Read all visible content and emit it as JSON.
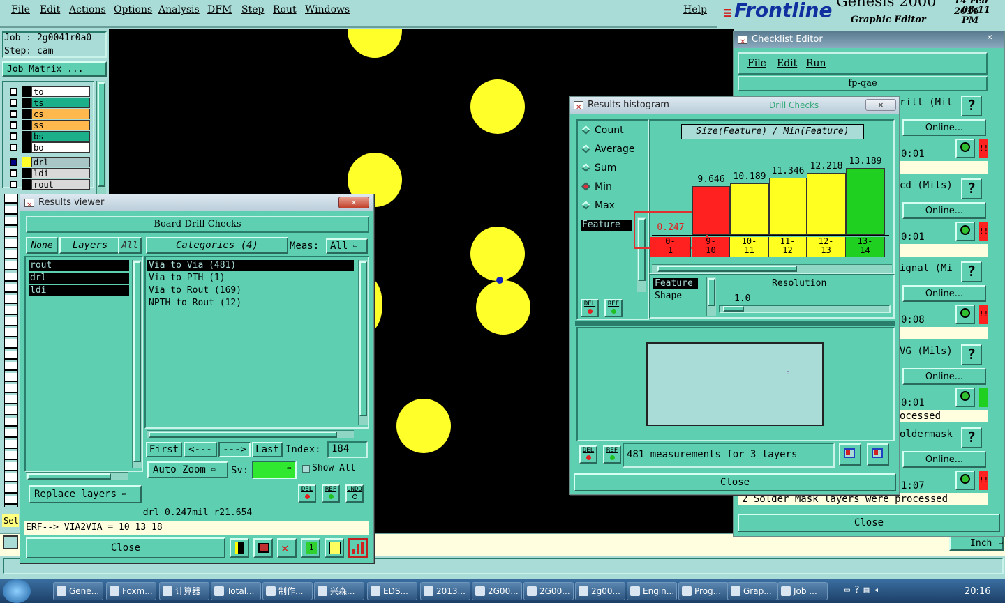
{
  "menubar": {
    "items": [
      "File",
      "Edit",
      "Actions",
      "Options",
      "Analysis",
      "DFM",
      "Step",
      "Rout",
      "Windows"
    ],
    "help": "Help"
  },
  "brand": {
    "logo": "Frontline",
    "product": "Genesis 2000",
    "subtitle": "Graphic Editor",
    "date": "14 Feb 2016",
    "time": "08:11 PM"
  },
  "left": {
    "job": "Job : 2g0041r0a0",
    "step": "Step: cam",
    "job_matrix": "Job Matrix ...",
    "layers": [
      {
        "name": "to",
        "color": "#ffffff"
      },
      {
        "name": "ts",
        "color": "#1cb08a"
      },
      {
        "name": "cs",
        "color": "#ffb84d"
      },
      {
        "name": "ss",
        "color": "#ffb84d"
      },
      {
        "name": "bs",
        "color": "#1cb08a"
      },
      {
        "name": "bo",
        "color": "#ffffff"
      },
      {
        "name": "drl",
        "color": "#a9c6c6"
      },
      {
        "name": "ldi",
        "color": "#d9d9d9"
      },
      {
        "name": "rout",
        "color": "#d9d9d9"
      }
    ],
    "sel_label": "Sel"
  },
  "results_viewer": {
    "title": "Results viewer",
    "header": "Board-Drill Checks",
    "none": "None",
    "layers": "Layers",
    "all": "All",
    "categories": "Categories (4)",
    "meas_label": "Meas:",
    "meas_value": "All",
    "layer_items": [
      "rout",
      "drl",
      "ldi"
    ],
    "category_items": [
      "Via to Via  (481)",
      "Via to PTH  (1)",
      "Via to Rout  (169)",
      "NPTH to Rout  (12)"
    ],
    "first": "First",
    "prev": "<---",
    "next": "--->",
    "last": "Last",
    "index_label": "Index:",
    "index_value": "184",
    "auto_zoom": "Auto Zoom",
    "sv_label": "Sv:",
    "show_all": "Show All",
    "replace_layers": "Replace layers",
    "status1": "drl 0.247mil  r21.654",
    "status2": "ERF--> VIA2VIA = 10 13 18",
    "close": "Close",
    "del": "DEL",
    "ref": "REF",
    "undo": "UNDO"
  },
  "histogram": {
    "title": "Results histogram",
    "modes": [
      "Count",
      "Average",
      "Sum",
      "Min",
      "Max"
    ],
    "selected_mode": "Min",
    "feature_label": "Feature",
    "chart_title": "Size(Feature) / Min(Feature)",
    "feature_shape_1": "Feature",
    "feature_shape_2": "Shape",
    "resolution_label": "Resolution",
    "resolution_value": "1.0",
    "measurements": "481 measurements for 3 layers",
    "close": "Close",
    "del": "DEL",
    "ref": "REF"
  },
  "chart_data": {
    "type": "bar",
    "title": "Size(Feature) / Min(Feature)",
    "categories": [
      "0-1",
      "9-10",
      "10-11",
      "11-12",
      "12-13",
      "13-14"
    ],
    "category_labels": [
      [
        "0-",
        "1"
      ],
      [
        "9-",
        "10"
      ],
      [
        "10-",
        "11"
      ],
      [
        "11-",
        "12"
      ],
      [
        "12-",
        "13"
      ],
      [
        "13-",
        "14"
      ]
    ],
    "values": [
      0.247,
      9.646,
      10.189,
      11.346,
      12.218,
      13.189
    ],
    "value_labels": [
      "0.247",
      "9.646",
      "10.189",
      "11.346",
      "12.218",
      "13.189"
    ],
    "colors": [
      "#ff2020",
      "#ff2020",
      "#ffff20",
      "#ffff20",
      "#ffff20",
      "#20d020"
    ]
  },
  "checklist": {
    "title": "Checklist Editor",
    "menu": [
      "File",
      "Edit",
      "Run"
    ],
    "name": "fp-qae",
    "rows": [
      {
        "label": "rill (Mil",
        "online": "Online...",
        "time": "0:01",
        "status": "#ff2020"
      },
      {
        "label": "cd (Mils)",
        "online": "Online...",
        "time": "0:01",
        "status": "#ff2020"
      },
      {
        "label": "ignal (Mi",
        "online": "Online...",
        "time": "0:08",
        "status": "#ff2020"
      },
      {
        "label": "VG (Mils)",
        "online": "Online...",
        "time": "0:01",
        "status": "#20d020"
      },
      {
        "label": "oldermask",
        "online": "Online...",
        "time": "1:07",
        "status": "#ff2020"
      }
    ],
    "processed": "ocessed",
    "footer_text": "2 Solder Mask layers were processed",
    "close": "Close",
    "drill_checks": "Drill Checks"
  },
  "unit": "Inch",
  "taskbar": {
    "items": [
      "Gene...",
      "Foxm...",
      "计算器",
      "Total...",
      "制作...",
      "兴森...",
      "EDS...",
      "2013...",
      "2G00...",
      "2G00...",
      "2g00...",
      "Engin...",
      "Prog...",
      "Grap...",
      "Job ..."
    ],
    "clock": "20:16"
  }
}
